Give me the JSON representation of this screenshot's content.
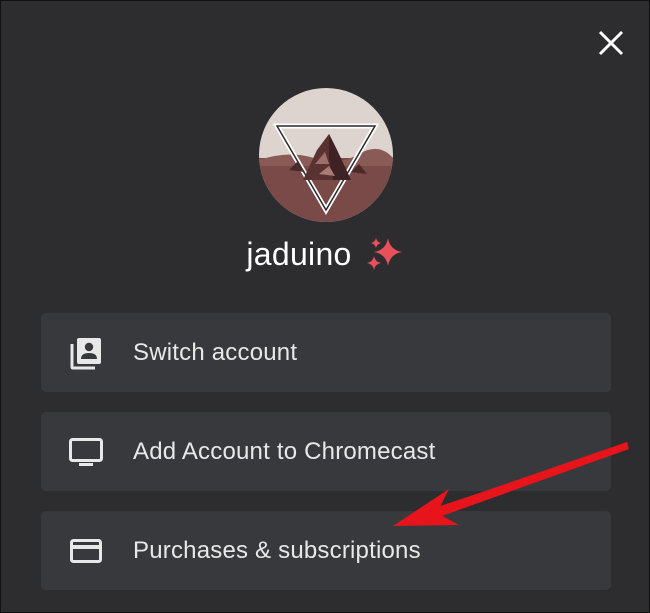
{
  "header": {
    "close_icon": "close-icon"
  },
  "profile": {
    "username": "jaduino",
    "username_emoji_icon": "sparkles-icon",
    "avatar_icon": "mountain-triangle-avatar"
  },
  "menu": {
    "items": [
      {
        "label": "Switch account",
        "icon": "switch-account-icon"
      },
      {
        "label": "Add Account to Chromecast",
        "icon": "tv-icon"
      },
      {
        "label": "Purchases & subscriptions",
        "icon": "credit-card-icon"
      }
    ]
  },
  "annotation": {
    "arrow_color": "#e8141c"
  },
  "colors": {
    "background": "#2d2d30",
    "menu_item_bg": "#38393c",
    "text": "#e8e8e8",
    "sparkle_accent": "#e8505b"
  }
}
